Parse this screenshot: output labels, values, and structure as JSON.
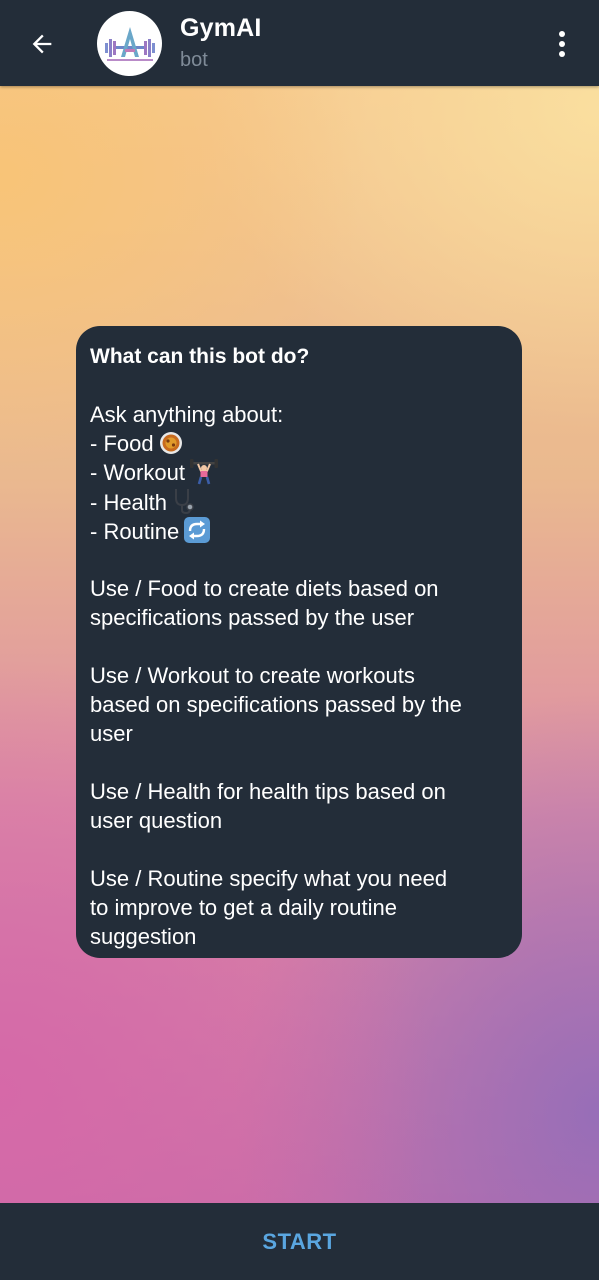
{
  "header": {
    "title": "GymAI",
    "subtitle": "bot",
    "back_icon": "arrow-left-icon",
    "menu_icon": "more-vertical-icon",
    "avatar_icon": "gym-logo-icon"
  },
  "bot_info": {
    "heading": "What can this bot do?",
    "intro": "Ask anything about:",
    "topics": [
      {
        "label": "- Food",
        "icon": "food-emoji-icon"
      },
      {
        "label": "- Workout",
        "icon": "weightlifter-emoji-icon"
      },
      {
        "label": "- Health",
        "icon": "stethoscope-emoji-icon"
      },
      {
        "label": "- Routine",
        "icon": "repeat-emoji-icon"
      }
    ],
    "paragraphs": [
      [
        "Use / Food to create diets based on",
        "specifications passed by the user"
      ],
      [
        "Use / Workout to create workouts",
        "based on specifications passed by the",
        "user"
      ],
      [
        "Use / Health for health tips based on",
        "user question"
      ],
      [
        "Use / Routine specify what you need",
        "to improve to get a daily routine",
        "suggestion"
      ]
    ]
  },
  "footer": {
    "start_label": "START"
  },
  "colors": {
    "header_bg": "#232d39",
    "bubble_bg": "#232d39",
    "accent": "#5aa6e0",
    "subtitle": "#7f8b98"
  }
}
